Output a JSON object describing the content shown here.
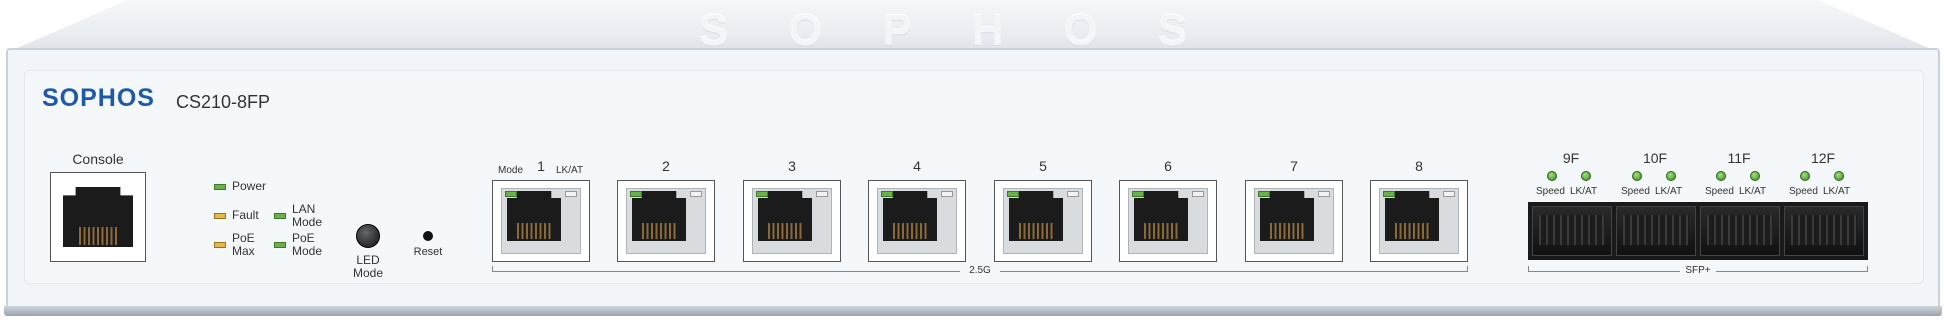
{
  "lid": {
    "logo_text": "SOPHOS"
  },
  "front": {
    "brand": "SOPHOS",
    "model": "CS210-8FP"
  },
  "console": {
    "label": "Console"
  },
  "status_leds": {
    "power": "Power",
    "fault": "Fault",
    "poe_max": "PoE\nMax",
    "lan_mode": "LAN\nMode",
    "poe_mode": "PoE\nMode"
  },
  "buttons": {
    "led_mode": "LED\nMode",
    "reset": "Reset"
  },
  "rj45": {
    "mode_label": "Mode",
    "lkat_label": "LK/AT",
    "ports": [
      "1",
      "2",
      "3",
      "4",
      "5",
      "6",
      "7",
      "8"
    ],
    "group_label": "2.5G"
  },
  "sfp": {
    "ports": [
      "9F",
      "10F",
      "11F",
      "12F"
    ],
    "speed_label": "Speed",
    "lkat_label": "LK/AT",
    "group_label": "SFP+"
  },
  "colors": {
    "brand_blue": "#1e5aa8",
    "led_green": "#6ab04c",
    "led_amber": "#e8b84a"
  }
}
